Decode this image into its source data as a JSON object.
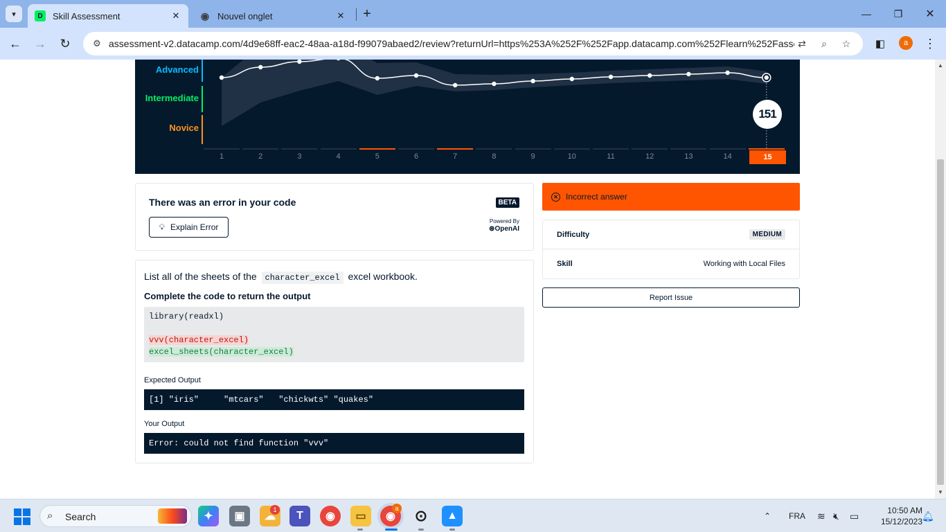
{
  "browser": {
    "tabs": [
      {
        "title": "Skill Assessment",
        "favicon": "datacamp-icon",
        "active": true
      },
      {
        "title": "Nouvel onglet",
        "favicon": "chrome-icon",
        "active": false
      }
    ],
    "url": "assessment-v2.datacamp.com/4d9e68ff-eac2-48aa-a18d-f99079abaed2/review?returnUrl=https%253A%252F%252Fapp.datacamp.com%252Flearn%252Fasse...",
    "profile_initial": "a"
  },
  "chart": {
    "levels": [
      {
        "label": "Advanced",
        "color": "#06bdfc"
      },
      {
        "label": "Intermediate",
        "color": "#03ef62"
      },
      {
        "label": "Novice",
        "color": "#ff931e"
      }
    ],
    "questions": [
      "1",
      "2",
      "3",
      "4",
      "5",
      "6",
      "7",
      "8",
      "9",
      "10",
      "11",
      "12",
      "13",
      "14",
      "15"
    ],
    "wrong_questions": [
      5,
      7,
      15
    ],
    "current_question": "15",
    "score": "151"
  },
  "chart_data": {
    "type": "line",
    "categories": [
      "1",
      "2",
      "3",
      "4",
      "5",
      "6",
      "7",
      "8",
      "9",
      "10",
      "11",
      "12",
      "13",
      "14",
      "15"
    ],
    "series": [
      {
        "values": [
          112,
          97,
          89,
          84,
          113,
          109,
          123,
          121,
          117,
          114,
          111,
          109,
          107,
          105,
          112
        ]
      }
    ],
    "ylim": [
      80,
      185
    ],
    "final_score": 151
  },
  "error_card": {
    "title": "There was an error in your code",
    "badge": "BETA",
    "explain_label": "Explain Error",
    "powered_by": "Powered By",
    "brand": "OpenAI"
  },
  "question": {
    "prompt_before": "List all of the sheets of the",
    "prompt_code": "character_excel",
    "prompt_after": "excel workbook.",
    "subhead": "Complete the code to return the output",
    "code_lines": [
      "library(readxl)",
      "",
      "vvv(character_excel)",
      "excel_sheets(character_excel)"
    ],
    "expected_label": "Expected Output",
    "expected_output": "[1] \"iris\"     \"mtcars\"   \"chickwts\" \"quakes\"",
    "your_label": "Your Output",
    "your_output": "Error: could not find function \"vvv\""
  },
  "result": {
    "status": "Incorrect answer",
    "difficulty_key": "Difficulty",
    "difficulty_value": "MEDIUM",
    "skill_key": "Skill",
    "skill_value": "Working with Local Files",
    "report_label": "Report Issue"
  },
  "taskbar": {
    "search_placeholder": "Search",
    "language": "FRA",
    "time": "10:50 AM",
    "date": "15/12/2023",
    "notif_badge": "1",
    "chrome_badge": "a"
  }
}
